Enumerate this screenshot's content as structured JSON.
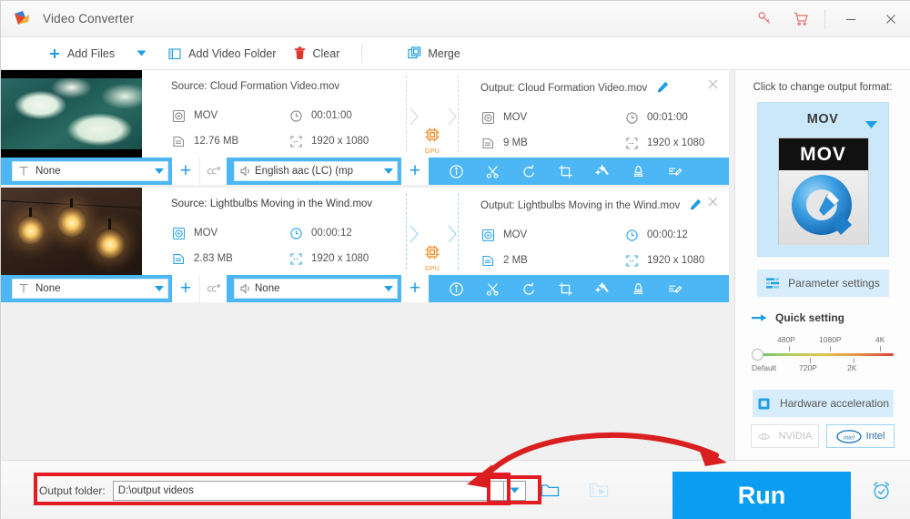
{
  "window": {
    "title": "Video Converter",
    "icons": {
      "key": "key-icon",
      "cart": "cart-icon",
      "minimize": "minimize-icon",
      "close": "close-icon"
    }
  },
  "toolbar": {
    "add_files": "Add Files",
    "add_files_caret": "dropdown-caret-icon",
    "add_video_folder": "Add Video Folder",
    "clear": "Clear",
    "merge": "Merge"
  },
  "list": {
    "items": [
      {
        "thumb": "clouds-thumbnail",
        "source": {
          "title": "Source: Cloud Formation Video.mov",
          "format": "MOV",
          "duration": "00:01:00",
          "size": "12.76 MB",
          "resolution": "1920 x 1080"
        },
        "output": {
          "title": "Output: Cloud Formation Video.mov",
          "format": "MOV",
          "duration": "00:01:00",
          "size": "9 MB",
          "resolution": "1920 x 1080"
        },
        "gpu_badge": "GPU",
        "subtitle_track": "None",
        "audio_track": "English aac (LC) (mp",
        "selected": false
      },
      {
        "thumb": "lightbulbs-thumbnail",
        "source": {
          "title": "Source: Lightbulbs Moving in the Wind.mov",
          "format": "MOV",
          "duration": "00:00:12",
          "size": "2.83 MB",
          "resolution": "1920 x 1080"
        },
        "output": {
          "title": "Output: Lightbulbs Moving in the Wind.mov",
          "format": "MOV",
          "duration": "00:00:12",
          "size": "2 MB",
          "resolution": "1920 x 1080"
        },
        "gpu_badge": "GPU",
        "subtitle_track": "None",
        "audio_track": "None",
        "selected": true
      }
    ],
    "action_icons": [
      "info-icon",
      "cut-icon",
      "rotate-icon",
      "crop-icon",
      "effect-icon",
      "watermark-icon",
      "subtitle-edit-icon"
    ]
  },
  "right_panel": {
    "prompt": "Click to change output format:",
    "format_name": "MOV",
    "format_icon_label": "MOV",
    "parameter_settings": "Parameter settings",
    "quick_setting": "Quick setting",
    "slider": {
      "top_ticks": [
        "480P",
        "1080P",
        "4K"
      ],
      "bottom_ticks": [
        "Default",
        "720P",
        "2K"
      ],
      "value": "Default"
    },
    "hardware_acceleration": "Hardware acceleration",
    "vendors": [
      {
        "label": "NVIDIA",
        "enabled": false
      },
      {
        "label": "Intel",
        "enabled": true
      }
    ]
  },
  "bottom": {
    "output_folder_label": "Output folder:",
    "output_folder_path": "D:\\output videos",
    "dropdown_icon": "dropdown-caret-icon",
    "folder_icon": "open-folder-icon",
    "preview_icon": "preview-folder-icon",
    "run_label": "Run",
    "clock_icon": "alarm-clock-icon"
  },
  "colors": {
    "accent_blue": "#0b9ef0",
    "bar_blue": "#4db7f5",
    "annotation_red": "#e31b23",
    "gpu_orange": "#f08a1d"
  }
}
